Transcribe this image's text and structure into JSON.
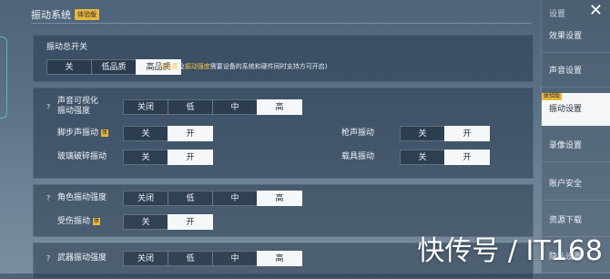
{
  "header": {
    "title": "振动系统",
    "badge": "体验版"
  },
  "master": {
    "label": "振动总开关",
    "options": [
      "关",
      "低品质",
      "高品质"
    ],
    "selected": 2,
    "hint_prefix": "(",
    "hint_hl1": "高品质",
    "hint_mid1": "及",
    "hint_hl2": "振动强度",
    "hint_rest": "需要设备的系统和硬件同时支持方可开启)"
  },
  "sound_section": {
    "intensity_label_line1": "声音可视化",
    "intensity_label_line2": "振动强度",
    "intensity_options": [
      "关闭",
      "低",
      "中",
      "高"
    ],
    "intensity_selected": 3,
    "footstep_label": "脚步声振动",
    "glass_label": "玻璃破碎振动",
    "gunshot_label": "枪声振动",
    "vehicle_label": "载具振动",
    "toggle_options": [
      "关",
      "开"
    ]
  },
  "char_section": {
    "intensity_label": "角色振动强度",
    "intensity_options": [
      "关闭",
      "低",
      "中",
      "高"
    ],
    "intensity_selected": 3,
    "hurt_label": "受伤振动",
    "toggle_options": [
      "关",
      "开"
    ]
  },
  "more_section": {
    "intensity_label": "武器振动强度",
    "intensity_options": [
      "关闭",
      "低",
      "中",
      "高"
    ]
  },
  "sidebar": {
    "header": "设置",
    "close": "✕",
    "badge": "体验版",
    "items": [
      "效果设置",
      "声音设置",
      "振动设置",
      "录像设置",
      "账户安全",
      "资源下载",
      "隐私设置"
    ],
    "active_index": 2
  },
  "watermark": "快传号 / IT168",
  "colors": {
    "accent": "#f3c34b",
    "active_option": "#f5f7f9",
    "badge": "#e8b73e"
  }
}
